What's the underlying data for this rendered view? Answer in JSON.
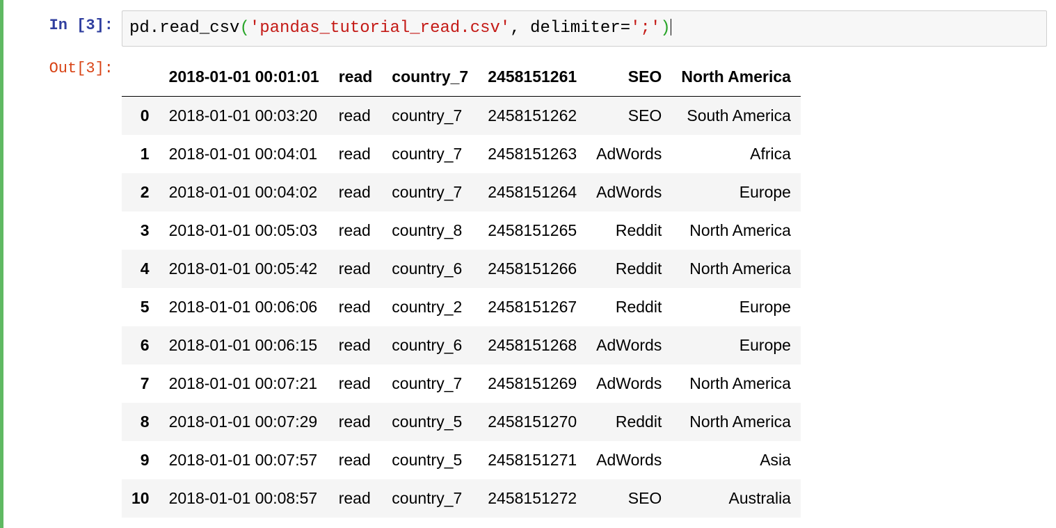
{
  "input_prompt": "In [3]:",
  "output_prompt": "Out[3]:",
  "code": {
    "leading": "pd.read_csv",
    "paren_open": "(",
    "string1": "'pandas_tutorial_read.csv'",
    "sep": ", delimiter=",
    "string2": "';'",
    "paren_close": ")"
  },
  "table": {
    "headers": [
      "2018-01-01 00:01:01",
      "read",
      "country_7",
      "2458151261",
      "SEO",
      "North America"
    ],
    "rows": [
      {
        "idx": "0",
        "cells": [
          "2018-01-01 00:03:20",
          "read",
          "country_7",
          "2458151262",
          "SEO",
          "South America"
        ]
      },
      {
        "idx": "1",
        "cells": [
          "2018-01-01 00:04:01",
          "read",
          "country_7",
          "2458151263",
          "AdWords",
          "Africa"
        ]
      },
      {
        "idx": "2",
        "cells": [
          "2018-01-01 00:04:02",
          "read",
          "country_7",
          "2458151264",
          "AdWords",
          "Europe"
        ]
      },
      {
        "idx": "3",
        "cells": [
          "2018-01-01 00:05:03",
          "read",
          "country_8",
          "2458151265",
          "Reddit",
          "North America"
        ]
      },
      {
        "idx": "4",
        "cells": [
          "2018-01-01 00:05:42",
          "read",
          "country_6",
          "2458151266",
          "Reddit",
          "North America"
        ]
      },
      {
        "idx": "5",
        "cells": [
          "2018-01-01 00:06:06",
          "read",
          "country_2",
          "2458151267",
          "Reddit",
          "Europe"
        ]
      },
      {
        "idx": "6",
        "cells": [
          "2018-01-01 00:06:15",
          "read",
          "country_6",
          "2458151268",
          "AdWords",
          "Europe"
        ]
      },
      {
        "idx": "7",
        "cells": [
          "2018-01-01 00:07:21",
          "read",
          "country_7",
          "2458151269",
          "AdWords",
          "North America"
        ]
      },
      {
        "idx": "8",
        "cells": [
          "2018-01-01 00:07:29",
          "read",
          "country_5",
          "2458151270",
          "Reddit",
          "North America"
        ]
      },
      {
        "idx": "9",
        "cells": [
          "2018-01-01 00:07:57",
          "read",
          "country_5",
          "2458151271",
          "AdWords",
          "Asia"
        ]
      },
      {
        "idx": "10",
        "cells": [
          "2018-01-01 00:08:57",
          "read",
          "country_7",
          "2458151272",
          "SEO",
          "Australia"
        ]
      }
    ]
  }
}
